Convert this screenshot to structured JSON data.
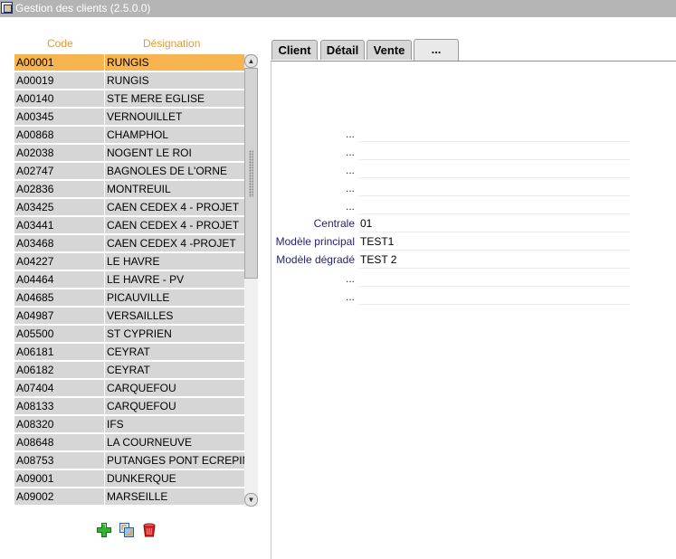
{
  "window": {
    "title": "Gestion des clients (2.5.0.0)"
  },
  "list": {
    "headers": {
      "code": "Code",
      "designation": "Désignation"
    },
    "selected_index": 0,
    "rows": [
      {
        "code": "A00001",
        "designation": "RUNGIS"
      },
      {
        "code": "A00019",
        "designation": "RUNGIS"
      },
      {
        "code": "A00140",
        "designation": "STE MERE EGLISE"
      },
      {
        "code": "A00345",
        "designation": "VERNOUILLET"
      },
      {
        "code": "A00868",
        "designation": "CHAMPHOL"
      },
      {
        "code": "A02038",
        "designation": "NOGENT LE ROI"
      },
      {
        "code": "A02747",
        "designation": "BAGNOLES DE L'ORNE"
      },
      {
        "code": "A02836",
        "designation": "MONTREUIL"
      },
      {
        "code": "A03425",
        "designation": "CAEN CEDEX 4 - PROJET"
      },
      {
        "code": "A03441",
        "designation": "CAEN CEDEX 4 - PROJET"
      },
      {
        "code": "A03468",
        "designation": "CAEN CEDEX 4 -PROJET"
      },
      {
        "code": "A04227",
        "designation": "LE HAVRE"
      },
      {
        "code": "A04464",
        "designation": "LE HAVRE - PV"
      },
      {
        "code": "A04685",
        "designation": "PICAUVILLE"
      },
      {
        "code": "A04987",
        "designation": "VERSAILLES"
      },
      {
        "code": "A05500",
        "designation": "ST CYPRIEN"
      },
      {
        "code": "A06181",
        "designation": "CEYRAT"
      },
      {
        "code": "A06182",
        "designation": "CEYRAT"
      },
      {
        "code": "A07404",
        "designation": "CARQUEFOU"
      },
      {
        "code": "A08133",
        "designation": "CARQUEFOU"
      },
      {
        "code": "A08320",
        "designation": "IFS"
      },
      {
        "code": "A08648",
        "designation": "LA COURNEUVE"
      },
      {
        "code": "A08753",
        "designation": "PUTANGES PONT ECREPIN"
      },
      {
        "code": "A09001",
        "designation": "DUNKERQUE"
      },
      {
        "code": "A09002",
        "designation": "MARSEILLE"
      }
    ]
  },
  "toolbar": {
    "add_icon": "add-plus-icon",
    "refresh_icon": "refresh-icon",
    "delete_icon": "delete-trash-icon"
  },
  "tabs": [
    {
      "label": "Client"
    },
    {
      "label": "Détail"
    },
    {
      "label": "Vente"
    },
    {
      "label": "..."
    }
  ],
  "form": {
    "fields": [
      {
        "label": "...",
        "value": ""
      },
      {
        "label": "...",
        "value": ""
      },
      {
        "label": "...",
        "value": ""
      },
      {
        "label": "...",
        "value": ""
      },
      {
        "label": "...",
        "value": ""
      },
      {
        "label": "Centrale",
        "value": "01"
      },
      {
        "label": "Modèle principal",
        "value": "TEST1"
      },
      {
        "label": "Modèle dégradé",
        "value": "TEST 2"
      },
      {
        "label": "...",
        "value": ""
      },
      {
        "label": "...",
        "value": ""
      }
    ]
  },
  "colors": {
    "header_text": "#e49a2e",
    "selected_row": "#f7b44f",
    "row_bg": "#d6d6d6",
    "label_text": "#23237a",
    "titlebar_bg": "#b4b4b4"
  }
}
